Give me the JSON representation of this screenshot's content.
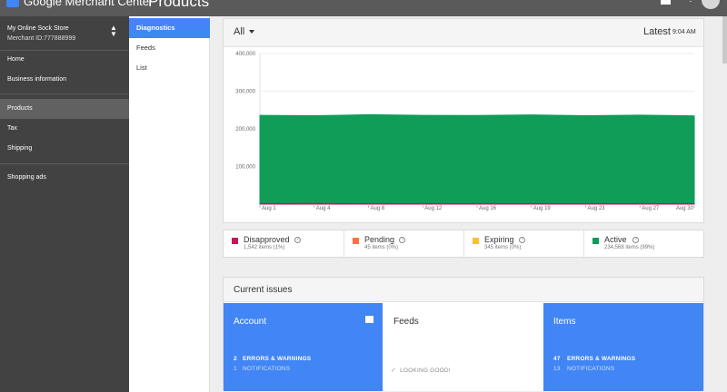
{
  "topbar": {
    "app_title": "Google Merchant Center",
    "page_title": "Products",
    "icons": [
      "logo-icon",
      "help-icon",
      "more-vert-icon",
      "avatar"
    ]
  },
  "sidebar": {
    "store_name": "My Online Sock Store",
    "merchant_id": "Merchant ID:777888999",
    "items": [
      {
        "label": "Home"
      },
      {
        "label": "Business information"
      },
      {
        "label": "Products",
        "active": true
      },
      {
        "label": "Tax"
      },
      {
        "label": "Shipping"
      },
      {
        "label": "Shopping ads"
      }
    ]
  },
  "subnav": {
    "items": [
      {
        "label": "Diagnostics",
        "active": true
      },
      {
        "label": "Feeds"
      },
      {
        "label": "List"
      }
    ]
  },
  "chart_header": {
    "filter": "All",
    "latest_label": "Latest",
    "latest_time": "9:04 AM"
  },
  "chart_data": {
    "type": "area",
    "x": [
      "Aug 1",
      "Aug 4",
      "Aug 8",
      "Aug 12",
      "Aug 16",
      "Aug 19",
      "Aug 23",
      "Aug 27",
      "Aug 30"
    ],
    "y_ticks": [
      "100,000",
      "200,000",
      "300,000",
      "400,000"
    ],
    "ylim": [
      0,
      400000
    ],
    "series": [
      {
        "name": "Active",
        "color": "#0f9d58",
        "values": [
          236000,
          235000,
          237500,
          236000,
          235500,
          237000,
          235000,
          236500,
          234568
        ]
      },
      {
        "name": "Disapproved",
        "color": "#c2185b",
        "values": [
          1500,
          1600,
          1550,
          1500,
          1560,
          1520,
          1540,
          1530,
          1542
        ]
      }
    ],
    "grid": true
  },
  "legend": [
    {
      "label": "Disapproved",
      "sub": "1,542 items (1%)",
      "color": "#c2185b"
    },
    {
      "label": "Pending",
      "sub": "45 items (0%)",
      "color": "#ff7043"
    },
    {
      "label": "Expiring",
      "sub": "345 items (0%)",
      "color": "#fbc02d"
    },
    {
      "label": "Active",
      "sub": "234,568 items (99%)",
      "color": "#0f9d58"
    }
  ],
  "issues": {
    "title": "Current issues",
    "account": {
      "title": "Account",
      "errors_count": "2",
      "errors_label": "ERRORS & WARNINGS",
      "notif_count": "1",
      "notif_label": "NOTIFICATIONS"
    },
    "feeds": {
      "title": "Feeds",
      "status": "LOOKING GOOD!"
    },
    "items": {
      "title": "Items",
      "errors_count": "47",
      "errors_label": "ERRORS & WARNINGS",
      "notif_count": "13",
      "notif_label": "NOTIFICATIONS"
    }
  }
}
